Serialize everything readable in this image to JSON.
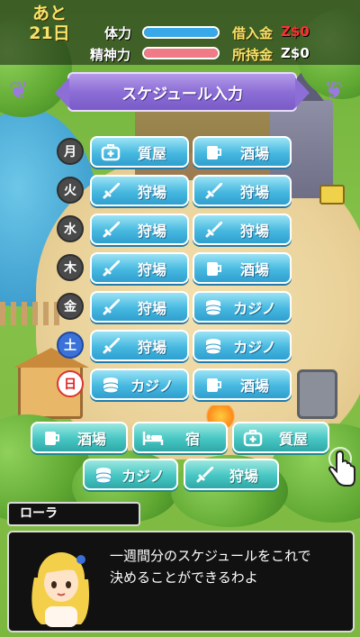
{
  "hud": {
    "days_prefix": "あと",
    "days_count": "21日",
    "stamina_label": "体力",
    "stamina_level": 1.0,
    "stamina_color": "#39a8e8",
    "mental_label": "精神力",
    "mental_level": 1.0,
    "mental_color": "#f07a86",
    "debt_label": "借入金",
    "debt_value": "Z$0",
    "debt_color": "#ff3030",
    "cash_label": "所持金",
    "cash_value": "Z$0",
    "cash_color": "#ffffff"
  },
  "title": "スケジュール入力",
  "schedule": [
    {
      "day": "月",
      "slot1": {
        "label": "質屋",
        "icon": "first-aid-bag-icon"
      },
      "slot2": {
        "label": "酒場",
        "icon": "mug-icon"
      }
    },
    {
      "day": "火",
      "slot1": {
        "label": "狩場",
        "icon": "sword-icon"
      },
      "slot2": {
        "label": "狩場",
        "icon": "sword-icon"
      }
    },
    {
      "day": "水",
      "slot1": {
        "label": "狩場",
        "icon": "sword-icon"
      },
      "slot2": {
        "label": "狩場",
        "icon": "sword-icon"
      }
    },
    {
      "day": "木",
      "slot1": {
        "label": "狩場",
        "icon": "sword-icon"
      },
      "slot2": {
        "label": "酒場",
        "icon": "mug-icon"
      }
    },
    {
      "day": "金",
      "slot1": {
        "label": "狩場",
        "icon": "sword-icon"
      },
      "slot2": {
        "label": "カジノ",
        "icon": "coins-icon"
      }
    },
    {
      "day": "土",
      "slot1": {
        "label": "狩場",
        "icon": "sword-icon"
      },
      "slot2": {
        "label": "カジノ",
        "icon": "coins-icon"
      }
    },
    {
      "day": "日",
      "slot1": {
        "label": "カジノ",
        "icon": "coins-icon"
      },
      "slot2": {
        "label": "酒場",
        "icon": "mug-icon"
      }
    }
  ],
  "options": [
    {
      "label": "酒場",
      "icon": "mug-icon"
    },
    {
      "label": "宿",
      "icon": "bed-icon"
    },
    {
      "label": "質屋",
      "icon": "first-aid-bag-icon"
    },
    {
      "label": "カジノ",
      "icon": "coins-icon"
    },
    {
      "label": "狩場",
      "icon": "sword-icon"
    }
  ],
  "dialog": {
    "speaker": "ローラ",
    "line1": "一週間分のスケジュールをこれで",
    "line2": "決めることができるわよ"
  }
}
